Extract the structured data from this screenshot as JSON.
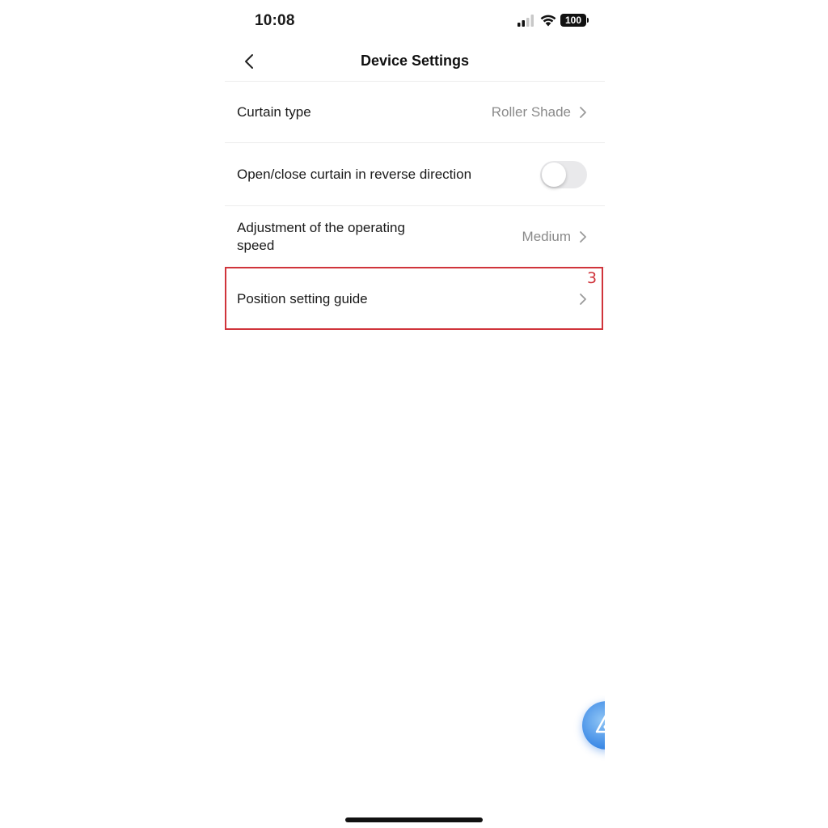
{
  "status_bar": {
    "time": "10:08",
    "battery": "100",
    "icons": [
      "signal-icon",
      "wifi-icon",
      "battery-icon"
    ]
  },
  "nav": {
    "title": "Device Settings",
    "back_icon": "back-chevron-icon"
  },
  "settings": [
    {
      "label": "Curtain type",
      "value": "Roller Shade",
      "type": "link"
    },
    {
      "label": "Open/close curtain in reverse direction",
      "type": "toggle",
      "on": false
    },
    {
      "label": "Adjustment of the operating speed",
      "value": "Medium",
      "type": "link"
    },
    {
      "label": "Position setting guide",
      "value": "",
      "type": "link"
    }
  ],
  "annotation": {
    "number": "3",
    "color": "#d0343b"
  },
  "colors": {
    "accent_blue": "#3d8ae6",
    "secondary_text": "#8a8a8a",
    "toggle_off": "#e9e9eb"
  }
}
